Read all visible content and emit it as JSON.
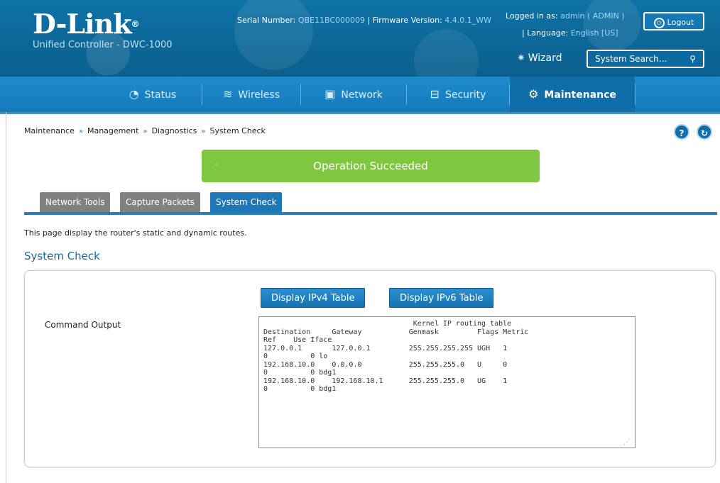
{
  "header": {
    "brand": "D-Link",
    "brand_mark": "®",
    "product": "Unified Controller - DWC-1000",
    "serial_label": "Serial Number:",
    "serial_value": "QBE11BC000009",
    "firmware_label": "Firmware Version:",
    "firmware_value": "4.4.0.1_WW",
    "logged_in_label": "Logged in as:",
    "logged_in_value": "admin ( ADMIN )",
    "logout_label": "Logout",
    "language_label": "Language:",
    "language_value": "English [US]",
    "wizard_label": "Wizard",
    "search_placeholder": "System Search..."
  },
  "nav": [
    {
      "label": "Status",
      "icon": "dashboard-icon"
    },
    {
      "label": "Wireless",
      "icon": "wifi-icon"
    },
    {
      "label": "Network",
      "icon": "monitor-icon"
    },
    {
      "label": "Security",
      "icon": "lock-icon"
    },
    {
      "label": "Maintenance",
      "icon": "gears-icon",
      "active": true
    }
  ],
  "breadcrumb": [
    "Maintenance",
    "Management",
    "Diagnostics",
    "System Check"
  ],
  "breadcrumb_sep": "»",
  "help_icons": [
    "?",
    "↻"
  ],
  "status_message": "Operation Succeeded",
  "tabs": [
    "Network Tools",
    "Capture Packets",
    "System Check"
  ],
  "active_tab": "System Check",
  "description": "This page display the router's static and dynamic routes.",
  "section_title": "System Check",
  "buttons": {
    "ipv4": "Display IPv4 Table",
    "ipv6": "Display IPv6 Table"
  },
  "command_output_label": "Command Output",
  "command_output": "                                   Kernel IP routing table\nDestination     Gateway           Genmask         Flags Metric\nRef    Use Iface\n127.0.0.1       127.0.0.1         255.255.255.255 UGH   1\n0          0 lo\n192.168.10.0    0.0.0.0           255.255.255.0   U     0\n0          0 bdg1\n192.168.10.0    192.168.10.1      255.255.255.0   UG    1\n0          0 bdg1",
  "colors": {
    "header_bg": "#0b5f8d",
    "nav_bg": "#1784c6",
    "success": "#7fc73f",
    "tab_active": "#1e78b8",
    "tab_inactive": "#818181"
  }
}
